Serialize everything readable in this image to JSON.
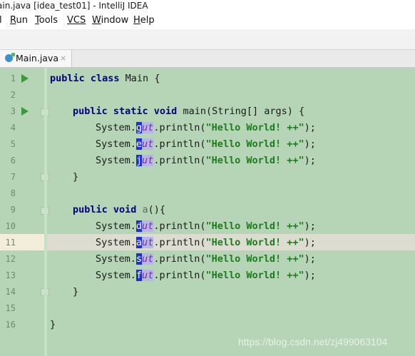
{
  "window": {
    "title": "ain.java [idea_test01] - IntelliJ IDEA"
  },
  "menu": [
    {
      "id": "run",
      "first": "R",
      "rest": "un"
    },
    {
      "id": "tools",
      "first": "T",
      "rest": "ools"
    },
    {
      "id": "vcs",
      "first": "VCS",
      "rest": ""
    },
    {
      "id": "window",
      "first": "W",
      "rest": "indow"
    },
    {
      "id": "help",
      "first": "H",
      "rest": "elp"
    }
  ],
  "menu_partial": "l",
  "tab": {
    "label": "Main.java",
    "close": "×"
  },
  "editor": {
    "line_numbers": [
      "1",
      "2",
      "3",
      "4",
      "5",
      "6",
      "7",
      "8",
      "9",
      "10",
      "11",
      "12",
      "13",
      "14",
      "15",
      "16"
    ],
    "code": {
      "class_kw": "public class",
      "class_name": " Main {",
      "main_kw": "public static void",
      "main_rest": " main(String[] args) {",
      "system": "System.",
      "ut_tail": "ut",
      "println": ".println(",
      "hello": "\"Hello World! ++\"",
      "end": ");",
      "close_brace": "}",
      "a_kw": "public void",
      "a_name": " a",
      "a_rest": "(){",
      "sel_chars": [
        "g",
        "e",
        "j",
        "d",
        "a",
        "s",
        "f"
      ]
    },
    "caret_line": "11"
  },
  "watermark": "https://blog.csdn.net/zj499063104"
}
